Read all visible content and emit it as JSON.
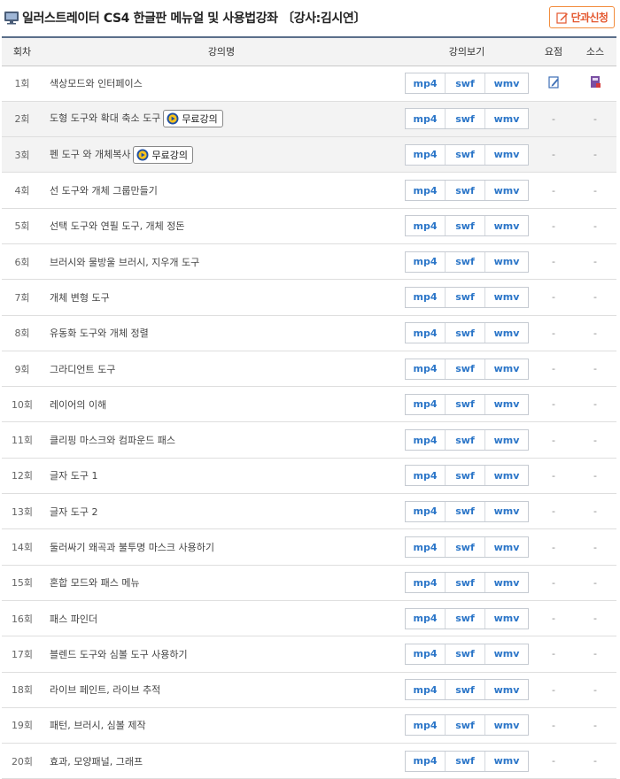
{
  "header": {
    "title": "일러스트레이터 CS4 한글판 메뉴얼 및 사용법강좌  〔강사:김시연〕",
    "apply_label": "단과신청"
  },
  "table": {
    "columns": [
      "회차",
      "강의명",
      "강의보기",
      "요점",
      "소스"
    ],
    "formats": [
      "mp4",
      "swf",
      "wmv"
    ],
    "free_label": "무료강의",
    "dash": "-",
    "rows": [
      {
        "no": "1회",
        "title": "색상모드와 인터페이스",
        "free": false,
        "summary": "memo-icon",
        "source": "book-icon"
      },
      {
        "no": "2회",
        "title": "도형 도구와 확대 축소 도구",
        "free": true,
        "summary": "-",
        "source": "-"
      },
      {
        "no": "3회",
        "title": "펜 도구 와 개체복사",
        "free": true,
        "summary": "-",
        "source": "-"
      },
      {
        "no": "4회",
        "title": "선 도구와 개체 그룹만들기",
        "free": false,
        "summary": "-",
        "source": "-"
      },
      {
        "no": "5회",
        "title": "선택 도구와 연필 도구, 개체 정돈",
        "free": false,
        "summary": "-",
        "source": "-"
      },
      {
        "no": "6회",
        "title": "브러시와 물방울 브러시, 지우개 도구",
        "free": false,
        "summary": "-",
        "source": "-"
      },
      {
        "no": "7회",
        "title": "개체 변형 도구",
        "free": false,
        "summary": "-",
        "source": "-"
      },
      {
        "no": "8회",
        "title": "유동화 도구와 개체 정렬",
        "free": false,
        "summary": "-",
        "source": "-"
      },
      {
        "no": "9회",
        "title": "그라디언트 도구",
        "free": false,
        "summary": "-",
        "source": "-"
      },
      {
        "no": "10회",
        "title": "레이어의 이해",
        "free": false,
        "summary": "-",
        "source": "-"
      },
      {
        "no": "11회",
        "title": "클리핑 마스크와 컴파운드 패스",
        "free": false,
        "summary": "-",
        "source": "-"
      },
      {
        "no": "12회",
        "title": "글자 도구 1",
        "free": false,
        "summary": "-",
        "source": "-"
      },
      {
        "no": "13회",
        "title": "글자 도구 2",
        "free": false,
        "summary": "-",
        "source": "-"
      },
      {
        "no": "14회",
        "title": "둘러싸기 왜곡과 불투명 마스크 사용하기",
        "free": false,
        "summary": "-",
        "source": "-"
      },
      {
        "no": "15회",
        "title": "혼합 모드와 패스 메뉴",
        "free": false,
        "summary": "-",
        "source": "-"
      },
      {
        "no": "16회",
        "title": "패스 파인더",
        "free": false,
        "summary": "-",
        "source": "-"
      },
      {
        "no": "17회",
        "title": "블렌드 도구와 심볼 도구 사용하기",
        "free": false,
        "summary": "-",
        "source": "-"
      },
      {
        "no": "18회",
        "title": "라이브 페인트, 라이브 추적",
        "free": false,
        "summary": "-",
        "source": "-"
      },
      {
        "no": "19회",
        "title": "패턴, 브러시, 심볼 제작",
        "free": false,
        "summary": "-",
        "source": "-"
      },
      {
        "no": "20회",
        "title": "효과, 모양패널, 그래프",
        "free": false,
        "summary": "-",
        "source": "-"
      }
    ]
  },
  "colors": {
    "accent": "#2a75c8",
    "apply": "#e4572e",
    "header_rule": "#5b6f8a"
  }
}
